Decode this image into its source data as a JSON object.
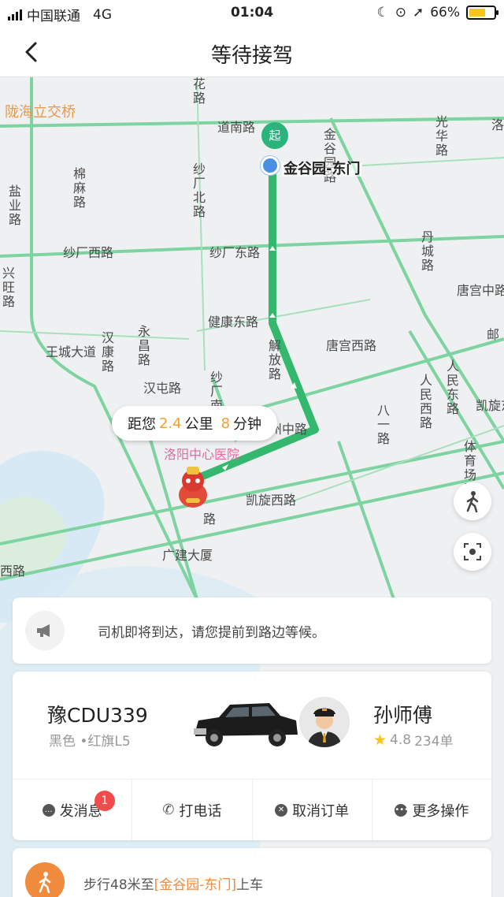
{
  "status_bar": {
    "carrier": "中国联通",
    "network": "4G",
    "time": "01:04",
    "battery_percent": "66%",
    "battery_level": 0.66
  },
  "nav": {
    "title": "等待接驾",
    "back_icon": "chevron-left-icon"
  },
  "map": {
    "labels": {
      "longhai": "陇海立交桥",
      "daonan": "道南路",
      "huahua": "花路",
      "jinguyuan_rd": "金谷园路",
      "guanghua": "光华路",
      "luo": "洛",
      "mianma": "棉麻路",
      "shachang_bei": "纱厂北路",
      "yanye": "盐业路",
      "shachang_xi": "纱厂西路",
      "shachang_dong": "纱厂东路",
      "dancheng": "丹城路",
      "xingwang": "兴旺路",
      "tanggong_zhong": "唐宫中路",
      "jiankang_dong": "健康东路",
      "you": "邮",
      "wangcheng": "王城大道",
      "hankang": "汉康路",
      "yongchang": "永昌路",
      "jiefang": "解放路",
      "tanggong_xi": "唐宫西路",
      "renmin_dong": "人民东路",
      "hantun": "汉屯路",
      "renmin_xi": "人民西路",
      "bayi": "八一路",
      "kaixuan_dong": "凯旋东路",
      "shachang_nan": "纱厂南路",
      "zhongzhou": "中州中路",
      "tiyuchang": "体育场路",
      "hospital": "洛阳中心医院",
      "lu": "路",
      "kaixuan_xi": "凯旋西路",
      "guangjian": "广建大厦",
      "xilu": "西路"
    },
    "destination_label": "金谷园-东门",
    "start_pin_label": "起",
    "distance_prefix": "距您",
    "distance_value": "2.4",
    "distance_unit": "公里",
    "eta_value": "8",
    "eta_unit": "分钟",
    "route_color": "#33b86e",
    "walk_icon": "walking-person-icon",
    "locate_icon": "locate-crosshair-icon"
  },
  "notice": {
    "icon": "megaphone-icon",
    "text": "司机即将到达，请您提前到路边等候。"
  },
  "driver": {
    "plate": "豫CDU339",
    "car_color": "黑色",
    "car_model": "•红旗L5",
    "name": "孙师傅",
    "rating": "4.8",
    "orders": "234单",
    "actions": {
      "message": "发消息",
      "message_badge": "1",
      "call": "打电话",
      "cancel": "取消订单",
      "more": "更多操作"
    }
  },
  "walk": {
    "prefix": "步行48米至",
    "place": "[金谷园-东门]",
    "suffix": "上车"
  },
  "colors": {
    "accent_orange": "#f08a3c",
    "badge_red": "#f24b4b",
    "star": "#f5c518"
  }
}
